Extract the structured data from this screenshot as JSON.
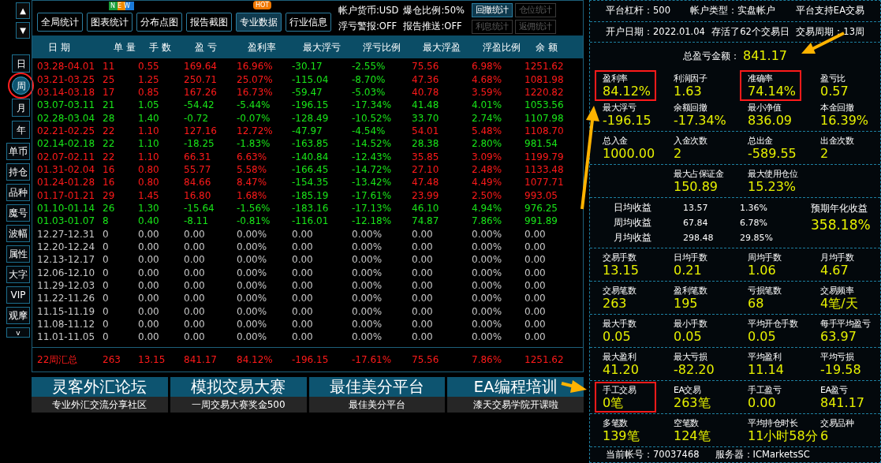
{
  "scroll_buttons": [
    "▲",
    "▼"
  ],
  "period_tabs": [
    {
      "label": "日",
      "selected": false,
      "circled": false
    },
    {
      "label": "周",
      "selected": true,
      "circled": true
    },
    {
      "label": "月",
      "selected": false,
      "circled": false
    },
    {
      "label": "年",
      "selected": false,
      "circled": false
    }
  ],
  "side_buttons": [
    "单币",
    "持仓",
    "品种",
    "魔号",
    "波幅",
    "属性",
    "大字",
    "VIP",
    "观摩",
    "v"
  ],
  "toolbar": [
    {
      "label": "全局统计",
      "selected": false
    },
    {
      "label": "图表统计",
      "selected": false,
      "badge": {
        "kind": "new",
        "text": "NEW"
      }
    },
    {
      "label": "分布点图",
      "selected": false
    },
    {
      "label": "报告截图",
      "selected": false
    },
    {
      "label": "专业数据",
      "selected": true,
      "badge": {
        "kind": "hot",
        "text": "HOT"
      }
    },
    {
      "label": "行业信息",
      "selected": false
    }
  ],
  "account_info": [
    "帐户货币:USD",
    "爆仓比例:50%",
    "浮亏警报:OFF",
    "报告推送:OFF"
  ],
  "stat_buttons": [
    {
      "label": "回撤统计",
      "disabled": false
    },
    {
      "label": "仓位统计",
      "disabled": true
    },
    {
      "label": "利息统计",
      "disabled": true
    },
    {
      "label": "返佣统计",
      "disabled": true
    }
  ],
  "table": {
    "columns": [
      {
        "label": "日 期",
        "kind": "text"
      },
      {
        "label": "单 量",
        "kind": "text"
      },
      {
        "label": "手 数",
        "kind": "text"
      },
      {
        "label": "盈 亏",
        "kind": "text"
      },
      {
        "label": "盈利率",
        "kind": "text"
      },
      {
        "label": "最大浮亏",
        "kind": "drawdown"
      },
      {
        "label": "浮亏比例",
        "kind": "drawdown"
      },
      {
        "label": "最大浮盈",
        "kind": "text"
      },
      {
        "label": "浮盈比例",
        "kind": "text"
      },
      {
        "label": "余 额",
        "kind": "text"
      }
    ],
    "rows": [
      {
        "loss": false,
        "empty": false,
        "cells": [
          "03.28-04.01",
          "11",
          "0.55",
          "169.64",
          "16.96%",
          "-30.17",
          "-2.55%",
          "75.56",
          "6.98%",
          "1251.62"
        ]
      },
      {
        "loss": false,
        "empty": false,
        "cells": [
          "03.21-03.25",
          "25",
          "1.25",
          "250.71",
          "25.07%",
          "-115.04",
          "-8.70%",
          "47.36",
          "4.68%",
          "1081.98"
        ]
      },
      {
        "loss": false,
        "empty": false,
        "cells": [
          "03.14-03.18",
          "17",
          "0.85",
          "167.26",
          "16.73%",
          "-59.47",
          "-5.03%",
          "40.78",
          "3.59%",
          "1220.82"
        ]
      },
      {
        "loss": true,
        "empty": false,
        "cells": [
          "03.07-03.11",
          "21",
          "1.05",
          "-54.42",
          "-5.44%",
          "-196.15",
          "-17.34%",
          "41.48",
          "4.01%",
          "1053.56"
        ]
      },
      {
        "loss": true,
        "empty": false,
        "cells": [
          "02.28-03.04",
          "28",
          "1.40",
          "-0.72",
          "-0.07%",
          "-128.49",
          "-10.52%",
          "33.70",
          "2.74%",
          "1107.98"
        ]
      },
      {
        "loss": false,
        "empty": false,
        "cells": [
          "02.21-02.25",
          "22",
          "1.10",
          "127.16",
          "12.72%",
          "-47.97",
          "-4.54%",
          "54.01",
          "5.48%",
          "1108.70"
        ]
      },
      {
        "loss": true,
        "empty": false,
        "cells": [
          "02.14-02.18",
          "22",
          "1.10",
          "-18.25",
          "-1.83%",
          "-163.85",
          "-14.52%",
          "28.38",
          "2.80%",
          "981.54"
        ]
      },
      {
        "loss": false,
        "empty": false,
        "cells": [
          "02.07-02.11",
          "22",
          "1.10",
          "66.31",
          "6.63%",
          "-140.84",
          "-12.43%",
          "35.85",
          "3.09%",
          "1199.79"
        ]
      },
      {
        "loss": false,
        "empty": false,
        "cells": [
          "01.31-02.04",
          "16",
          "0.80",
          "55.77",
          "5.58%",
          "-166.45",
          "-14.72%",
          "27.10",
          "2.48%",
          "1133.48"
        ]
      },
      {
        "loss": false,
        "empty": false,
        "cells": [
          "01.24-01.28",
          "16",
          "0.80",
          "84.66",
          "8.47%",
          "-154.35",
          "-13.42%",
          "47.48",
          "4.49%",
          "1077.71"
        ]
      },
      {
        "loss": false,
        "empty": false,
        "cells": [
          "01.17-01.21",
          "29",
          "1.45",
          "16.80",
          "1.68%",
          "-185.19",
          "-17.61%",
          "23.99",
          "2.50%",
          "993.05"
        ]
      },
      {
        "loss": true,
        "empty": false,
        "cells": [
          "01.10-01.14",
          "26",
          "1.30",
          "-15.64",
          "-1.56%",
          "-183.16",
          "-17.13%",
          "46.10",
          "4.94%",
          "976.25"
        ]
      },
      {
        "loss": true,
        "empty": false,
        "cells": [
          "01.03-01.07",
          "8",
          "0.40",
          "-8.11",
          "-0.81%",
          "-116.01",
          "-12.18%",
          "74.87",
          "7.86%",
          "991.89"
        ]
      },
      {
        "empty": true,
        "cells": [
          "12.27-12.31",
          "0",
          "0.00",
          "0.00",
          "0.00%",
          "0.00",
          "0.00%",
          "0.00",
          "0.00%",
          "0.00"
        ]
      },
      {
        "empty": true,
        "cells": [
          "12.20-12.24",
          "0",
          "0.00",
          "0.00",
          "0.00%",
          "0.00",
          "0.00%",
          "0.00",
          "0.00%",
          "0.00"
        ]
      },
      {
        "empty": true,
        "cells": [
          "12.13-12.17",
          "0",
          "0.00",
          "0.00",
          "0.00%",
          "0.00",
          "0.00%",
          "0.00",
          "0.00%",
          "0.00"
        ]
      },
      {
        "empty": true,
        "cells": [
          "12.06-12.10",
          "0",
          "0.00",
          "0.00",
          "0.00%",
          "0.00",
          "0.00%",
          "0.00",
          "0.00%",
          "0.00"
        ]
      },
      {
        "empty": true,
        "cells": [
          "11.29-12.03",
          "0",
          "0.00",
          "0.00",
          "0.00%",
          "0.00",
          "0.00%",
          "0.00",
          "0.00%",
          "0.00"
        ]
      },
      {
        "empty": true,
        "cells": [
          "11.22-11.26",
          "0",
          "0.00",
          "0.00",
          "0.00%",
          "0.00",
          "0.00%",
          "0.00",
          "0.00%",
          "0.00"
        ]
      },
      {
        "empty": true,
        "cells": [
          "11.15-11.19",
          "0",
          "0.00",
          "0.00",
          "0.00%",
          "0.00",
          "0.00%",
          "0.00",
          "0.00%",
          "0.00"
        ]
      },
      {
        "empty": true,
        "cells": [
          "11.08-11.12",
          "0",
          "0.00",
          "0.00",
          "0.00%",
          "0.00",
          "0.00%",
          "0.00",
          "0.00%",
          "0.00"
        ]
      },
      {
        "empty": true,
        "cells": [
          "11.01-11.05",
          "0",
          "0.00",
          "0.00",
          "0.00%",
          "0.00",
          "0.00%",
          "0.00",
          "0.00%",
          "0.00"
        ]
      }
    ],
    "summary": {
      "loss": false,
      "cells": [
        "22周汇总",
        "263",
        "13.15",
        "841.17",
        "84.12%",
        "-196.15",
        "-17.61%",
        "75.56",
        "7.86%",
        "1251.62"
      ]
    }
  },
  "banners": [
    {
      "title": "灵客外汇论坛",
      "subtitle": "专业外汇交流分享社区"
    },
    {
      "title": "模拟交易大赛",
      "subtitle": "一周交易大赛奖金500"
    },
    {
      "title": "最佳美分平台",
      "subtitle": "最佳美分平台"
    },
    {
      "title": "EA编程培训",
      "subtitle": "漆天交易学院开课啦"
    }
  ],
  "info_rows": [
    [
      "平台杠杆：500",
      "帐户类型：实盘帐户",
      "平台支持EA交易"
    ],
    [
      "开户日期：2022.01.04",
      "存活了62个交易日",
      "交易周期：13周"
    ]
  ],
  "total": {
    "label": "总盈亏金额：",
    "value": "841.17"
  },
  "stat_groups": [
    {
      "kind": "grid",
      "stats": [
        {
          "label": "盈利率",
          "value": "84.12%",
          "highlighted": true
        },
        {
          "label": "利润因子",
          "value": "1.63"
        },
        {
          "label": "准确率",
          "value": "74.14%",
          "highlighted": true
        },
        {
          "label": "盈亏比",
          "value": "0.57"
        },
        {
          "label": "最大浮亏",
          "value": "-196.15"
        },
        {
          "label": "余额回撤",
          "value": "-17.34%"
        },
        {
          "label": "最小净值",
          "value": "836.09"
        },
        {
          "label": "本金回撤",
          "value": "16.39%"
        }
      ]
    },
    {
      "kind": "grid",
      "stats": [
        {
          "label": "总入金",
          "value": "1000.00"
        },
        {
          "label": "入金次数",
          "value": "2"
        },
        {
          "label": "总出金",
          "value": "-589.55"
        },
        {
          "label": "出金次数",
          "value": "2"
        }
      ]
    },
    {
      "kind": "centered",
      "stats": [
        {
          "label": "最大占保证金",
          "value": "150.89"
        },
        {
          "label": "最大使用仓位",
          "value": "15.23%"
        }
      ]
    }
  ],
  "averages": {
    "rows": [
      [
        "日均收益",
        "13.57",
        "1.36%"
      ],
      [
        "周均收益",
        "67.84",
        "6.78%"
      ],
      [
        "月均收益",
        "298.48",
        "29.85%"
      ]
    ],
    "expected_label": "预期年化收益",
    "expected_value": "358.18%"
  },
  "stat_groups_2": [
    {
      "kind": "grid",
      "stats": [
        {
          "label": "交易手数",
          "value": "13.15"
        },
        {
          "label": "日均手数",
          "value": "0.21"
        },
        {
          "label": "周均手数",
          "value": "1.06"
        },
        {
          "label": "月均手数",
          "value": "4.67"
        }
      ]
    },
    {
      "kind": "grid",
      "stats": [
        {
          "label": "交易笔数",
          "value": "263"
        },
        {
          "label": "盈利笔数",
          "value": "195"
        },
        {
          "label": "亏损笔数",
          "value": "68"
        },
        {
          "label": "交易频率",
          "value": "4笔/天"
        }
      ]
    },
    {
      "kind": "grid",
      "stats": [
        {
          "label": "最大手数",
          "value": "0.05"
        },
        {
          "label": "最小手数",
          "value": "0.05"
        },
        {
          "label": "平均开仓手数",
          "value": "0.05"
        },
        {
          "label": "每手平均盈亏",
          "value": "63.97"
        }
      ]
    },
    {
      "kind": "grid",
      "stats": [
        {
          "label": "最大盈利",
          "value": "41.20"
        },
        {
          "label": "最大亏损",
          "value": "-82.20"
        },
        {
          "label": "平均盈利",
          "value": "11.14"
        },
        {
          "label": "平均亏损",
          "value": "-19.58"
        }
      ]
    },
    {
      "kind": "grid",
      "stats": [
        {
          "label": "手工交易",
          "value": "0笔",
          "highlighted": true
        },
        {
          "label": "EA交易",
          "value": "263笔"
        },
        {
          "label": "手工盈亏",
          "value": "0.00"
        },
        {
          "label": "EA盈亏",
          "value": "841.17"
        }
      ]
    },
    {
      "kind": "grid",
      "stats": [
        {
          "label": "多笔数",
          "value": "139笔"
        },
        {
          "label": "空笔数",
          "value": "124笔"
        },
        {
          "label": "平均持仓时长",
          "value": "11小时58分"
        },
        {
          "label": "交易品种",
          "value": "6"
        }
      ]
    }
  ],
  "footer": [
    "当前帐号：70037468",
    "服务器：ICMarketsSC"
  ]
}
